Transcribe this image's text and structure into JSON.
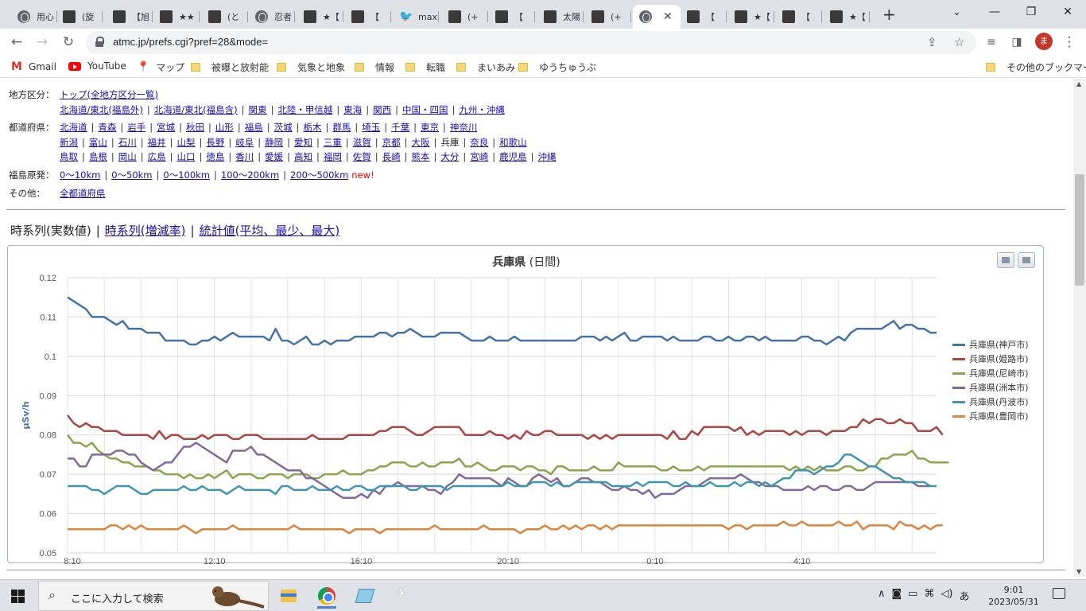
{
  "browser": {
    "tabs": [
      {
        "title": "用心",
        "icon": "globe-icon"
      },
      {
        "title": "(旋",
        "icon": "site-icon"
      },
      {
        "title": "【旭",
        "icon": "site-icon"
      },
      {
        "title": "★★",
        "icon": "site-icon"
      },
      {
        "title": "(と",
        "icon": "site-icon"
      },
      {
        "title": "忍者",
        "icon": "globe-icon"
      },
      {
        "title": "★【",
        "icon": "site-icon"
      },
      {
        "title": "【 ",
        "icon": "site-icon"
      },
      {
        "title": "max",
        "icon": "twitter-icon"
      },
      {
        "title": "(+",
        "icon": "site-icon"
      },
      {
        "title": "【 ",
        "icon": "site-icon"
      },
      {
        "title": "太陽",
        "icon": "site-icon"
      },
      {
        "title": "(+",
        "icon": "site-icon"
      },
      {
        "title": "",
        "icon": "globe-icon",
        "active": true
      },
      {
        "title": "【 ",
        "icon": "site-icon"
      },
      {
        "title": "★【",
        "icon": "site-icon"
      },
      {
        "title": "【 ",
        "icon": "site-icon"
      },
      {
        "title": "★【",
        "icon": "site-icon"
      }
    ],
    "url": "atmc.jp/prefs.cgi?pref=28&mode=",
    "profile_initial": "ま",
    "bookmarks": [
      {
        "label": "Gmail",
        "icon": "gmail-icon"
      },
      {
        "label": "YouTube",
        "icon": "youtube-icon"
      },
      {
        "label": "マップ",
        "icon": "maps-icon"
      },
      {
        "label": "被曝と放射能",
        "icon": "folder-icon"
      },
      {
        "label": "気象と地象",
        "icon": "folder-icon"
      },
      {
        "label": "情報",
        "icon": "folder-icon"
      },
      {
        "label": "転職",
        "icon": "folder-icon"
      },
      {
        "label": "まいあみ",
        "icon": "folder-icon"
      },
      {
        "label": "ゆうちゅうぶ",
        "icon": "folder-icon"
      },
      {
        "label": "その他のブックマーク",
        "icon": "folder-icon"
      }
    ]
  },
  "nav": {
    "region_label": "地方区分：",
    "region_top": "トップ(全地方区分一覧)",
    "regions": [
      "北海道/東北(福島外)",
      "北海道/東北(福島含)",
      "関東",
      "北陸・甲信越",
      "東海",
      "関西",
      "中国・四国",
      "九州・沖縄"
    ],
    "pref_label": "都道府県：",
    "prefs_row1": [
      "北海道",
      "青森",
      "岩手",
      "宮城",
      "秋田",
      "山形",
      "福島",
      "茨城",
      "栃木",
      "群馬",
      "埼玉",
      "千葉",
      "東京",
      "神奈川"
    ],
    "prefs_row2": [
      "新潟",
      "富山",
      "石川",
      "福井",
      "山梨",
      "長野",
      "岐阜",
      "静岡",
      "愛知",
      "三重",
      "滋賀",
      "京都",
      "大阪",
      "兵庫",
      "奈良",
      "和歌山"
    ],
    "prefs_row3": [
      "鳥取",
      "島根",
      "岡山",
      "広島",
      "山口",
      "徳島",
      "香川",
      "愛媛",
      "高知",
      "福岡",
      "佐賀",
      "長崎",
      "熊本",
      "大分",
      "宮崎",
      "鹿児島",
      "沖縄"
    ],
    "current_pref": "兵庫",
    "fukushima_label": "福島原発：",
    "fukushima": [
      "0〜10km",
      "0〜50km",
      "0〜100km",
      "100〜200km",
      "200〜500km"
    ],
    "new_mark": "new!",
    "other_label": "その他：",
    "other": "全都道府県"
  },
  "chart_tabs": {
    "current": "時系列(実数値)",
    "links": [
      "時系列(増減率)",
      "統計値(平均、最少、最大)"
    ]
  },
  "chart_data": {
    "type": "line",
    "title": "兵庫県",
    "subtitle": "(日間)",
    "xlabel": "",
    "ylabel": "μSv/h",
    "ylim": [
      0.05,
      0.12
    ],
    "yticks": [
      "0.05",
      "0.06",
      "0.07",
      "0.08",
      "0.09",
      "0.1",
      "0.11",
      "0.12"
    ],
    "x_tick_labels": [
      "8:10",
      "12:10",
      "16:10",
      "20:10",
      "0:10",
      "4:10"
    ],
    "x_tick_positions": [
      0,
      24,
      48,
      72,
      96,
      120
    ],
    "x_start": "8:10",
    "x_interval_minutes": 10,
    "grid": true,
    "legend_position": "right",
    "series": [
      {
        "name": "兵庫県(神戸市)",
        "color": "#4572a7",
        "values": [
          0.115,
          0.114,
          0.113,
          0.112,
          0.11,
          0.11,
          0.11,
          0.109,
          0.108,
          0.109,
          0.107,
          0.107,
          0.107,
          0.106,
          0.106,
          0.106,
          0.104,
          0.104,
          0.104,
          0.104,
          0.103,
          0.103,
          0.104,
          0.104,
          0.105,
          0.104,
          0.105,
          0.106,
          0.105,
          0.105,
          0.105,
          0.105,
          0.105,
          0.104,
          0.107,
          0.104,
          0.104,
          0.103,
          0.104,
          0.105,
          0.103,
          0.103,
          0.104,
          0.103,
          0.104,
          0.104,
          0.104,
          0.105,
          0.105,
          0.105,
          0.105,
          0.106,
          0.106,
          0.105,
          0.106,
          0.106,
          0.107,
          0.106,
          0.105,
          0.105,
          0.105,
          0.106,
          0.106,
          0.106,
          0.106,
          0.105,
          0.104,
          0.104,
          0.104,
          0.105,
          0.104,
          0.104,
          0.104,
          0.105,
          0.104,
          0.104,
          0.104,
          0.104,
          0.104,
          0.104,
          0.104,
          0.104,
          0.104,
          0.104,
          0.105,
          0.105,
          0.105,
          0.104,
          0.105,
          0.104,
          0.105,
          0.106,
          0.104,
          0.104,
          0.105,
          0.105,
          0.105,
          0.105,
          0.104,
          0.105,
          0.104,
          0.104,
          0.104,
          0.104,
          0.105,
          0.105,
          0.104,
          0.104,
          0.105,
          0.104,
          0.104,
          0.105,
          0.105,
          0.104,
          0.105,
          0.104,
          0.104,
          0.104,
          0.104,
          0.104,
          0.105,
          0.105,
          0.104,
          0.104,
          0.103,
          0.104,
          0.105,
          0.104,
          0.106,
          0.107,
          0.107,
          0.107,
          0.107,
          0.107,
          0.108,
          0.109,
          0.107,
          0.108,
          0.108,
          0.107,
          0.107,
          0.106,
          0.106
        ]
      },
      {
        "name": "兵庫県(姫路市)",
        "color": "#aa4643",
        "values": [
          0.085,
          0.083,
          0.082,
          0.083,
          0.082,
          0.082,
          0.081,
          0.081,
          0.081,
          0.08,
          0.08,
          0.08,
          0.08,
          0.08,
          0.079,
          0.081,
          0.079,
          0.08,
          0.08,
          0.079,
          0.079,
          0.079,
          0.08,
          0.079,
          0.08,
          0.08,
          0.08,
          0.079,
          0.079,
          0.08,
          0.08,
          0.08,
          0.079,
          0.079,
          0.079,
          0.079,
          0.079,
          0.079,
          0.079,
          0.079,
          0.08,
          0.079,
          0.079,
          0.079,
          0.079,
          0.079,
          0.08,
          0.08,
          0.08,
          0.08,
          0.08,
          0.081,
          0.081,
          0.082,
          0.082,
          0.082,
          0.081,
          0.08,
          0.08,
          0.081,
          0.082,
          0.082,
          0.082,
          0.082,
          0.082,
          0.08,
          0.08,
          0.08,
          0.08,
          0.081,
          0.08,
          0.08,
          0.079,
          0.08,
          0.079,
          0.081,
          0.08,
          0.08,
          0.081,
          0.081,
          0.08,
          0.08,
          0.08,
          0.08,
          0.08,
          0.079,
          0.08,
          0.079,
          0.08,
          0.079,
          0.08,
          0.08,
          0.08,
          0.08,
          0.08,
          0.08,
          0.08,
          0.08,
          0.079,
          0.081,
          0.079,
          0.079,
          0.081,
          0.08,
          0.082,
          0.082,
          0.082,
          0.082,
          0.082,
          0.081,
          0.082,
          0.08,
          0.081,
          0.08,
          0.081,
          0.081,
          0.081,
          0.081,
          0.08,
          0.081,
          0.08,
          0.081,
          0.081,
          0.081,
          0.08,
          0.081,
          0.081,
          0.081,
          0.082,
          0.082,
          0.084,
          0.083,
          0.084,
          0.084,
          0.083,
          0.083,
          0.084,
          0.083,
          0.083,
          0.081,
          0.081,
          0.081,
          0.082,
          0.08
        ]
      },
      {
        "name": "兵庫県(尼崎市)",
        "color": "#89a54e",
        "values": [
          0.08,
          0.078,
          0.078,
          0.077,
          0.078,
          0.076,
          0.075,
          0.074,
          0.074,
          0.073,
          0.073,
          0.072,
          0.072,
          0.072,
          0.071,
          0.071,
          0.07,
          0.07,
          0.07,
          0.069,
          0.07,
          0.069,
          0.069,
          0.07,
          0.069,
          0.07,
          0.071,
          0.069,
          0.07,
          0.07,
          0.07,
          0.069,
          0.069,
          0.07,
          0.07,
          0.07,
          0.069,
          0.07,
          0.07,
          0.07,
          0.069,
          0.069,
          0.07,
          0.07,
          0.07,
          0.071,
          0.07,
          0.07,
          0.07,
          0.071,
          0.071,
          0.072,
          0.072,
          0.073,
          0.073,
          0.073,
          0.072,
          0.072,
          0.073,
          0.072,
          0.072,
          0.073,
          0.073,
          0.073,
          0.074,
          0.072,
          0.072,
          0.073,
          0.072,
          0.071,
          0.071,
          0.072,
          0.072,
          0.072,
          0.071,
          0.072,
          0.072,
          0.071,
          0.071,
          0.07,
          0.072,
          0.072,
          0.071,
          0.071,
          0.071,
          0.071,
          0.072,
          0.071,
          0.071,
          0.071,
          0.073,
          0.072,
          0.072,
          0.072,
          0.072,
          0.072,
          0.072,
          0.071,
          0.071,
          0.072,
          0.071,
          0.071,
          0.071,
          0.072,
          0.071,
          0.072,
          0.072,
          0.072,
          0.072,
          0.072,
          0.072,
          0.072,
          0.072,
          0.072,
          0.072,
          0.072,
          0.072,
          0.072,
          0.071,
          0.072,
          0.071,
          0.072,
          0.071,
          0.072,
          0.071,
          0.071,
          0.071,
          0.072,
          0.072,
          0.071,
          0.071,
          0.072,
          0.072,
          0.074,
          0.074,
          0.075,
          0.075,
          0.075,
          0.076,
          0.074,
          0.074,
          0.073,
          0.073,
          0.073,
          0.073
        ]
      },
      {
        "name": "兵庫県(洲本市)",
        "color": "#80699b",
        "values": [
          0.074,
          0.074,
          0.072,
          0.072,
          0.075,
          0.075,
          0.075,
          0.075,
          0.076,
          0.076,
          0.075,
          0.075,
          0.073,
          0.072,
          0.071,
          0.072,
          0.073,
          0.073,
          0.075,
          0.077,
          0.077,
          0.078,
          0.077,
          0.076,
          0.075,
          0.074,
          0.073,
          0.076,
          0.076,
          0.076,
          0.077,
          0.075,
          0.075,
          0.074,
          0.073,
          0.072,
          0.071,
          0.071,
          0.071,
          0.069,
          0.069,
          0.068,
          0.067,
          0.066,
          0.065,
          0.064,
          0.064,
          0.064,
          0.065,
          0.064,
          0.066,
          0.065,
          0.067,
          0.067,
          0.068,
          0.067,
          0.067,
          0.067,
          0.067,
          0.066,
          0.066,
          0.065,
          0.067,
          0.068,
          0.07,
          0.069,
          0.069,
          0.069,
          0.069,
          0.069,
          0.068,
          0.067,
          0.069,
          0.068,
          0.067,
          0.067,
          0.069,
          0.07,
          0.069,
          0.068,
          0.069,
          0.067,
          0.067,
          0.068,
          0.069,
          0.069,
          0.068,
          0.068,
          0.067,
          0.066,
          0.066,
          0.067,
          0.066,
          0.066,
          0.065,
          0.066,
          0.064,
          0.065,
          0.065,
          0.065,
          0.066,
          0.067,
          0.067,
          0.067,
          0.068,
          0.069,
          0.069,
          0.069,
          0.069,
          0.069,
          0.07,
          0.069,
          0.068,
          0.068,
          0.067,
          0.067,
          0.067,
          0.066,
          0.066,
          0.066,
          0.066,
          0.067,
          0.066,
          0.067,
          0.067,
          0.066,
          0.066,
          0.067,
          0.067,
          0.066,
          0.066,
          0.067,
          0.068,
          0.068,
          0.068,
          0.068,
          0.068,
          0.068,
          0.068,
          0.067,
          0.067,
          0.067
        ]
      },
      {
        "name": "兵庫県(丹波市)",
        "color": "#3d96ae",
        "values": [
          0.067,
          0.067,
          0.067,
          0.067,
          0.066,
          0.066,
          0.065,
          0.066,
          0.067,
          0.067,
          0.067,
          0.066,
          0.065,
          0.065,
          0.066,
          0.066,
          0.066,
          0.066,
          0.066,
          0.067,
          0.066,
          0.066,
          0.067,
          0.066,
          0.066,
          0.066,
          0.065,
          0.066,
          0.067,
          0.066,
          0.066,
          0.066,
          0.066,
          0.066,
          0.065,
          0.067,
          0.067,
          0.066,
          0.066,
          0.066,
          0.067,
          0.066,
          0.066,
          0.066,
          0.067,
          0.066,
          0.066,
          0.067,
          0.067,
          0.066,
          0.066,
          0.067,
          0.067,
          0.067,
          0.067,
          0.067,
          0.066,
          0.066,
          0.067,
          0.067,
          0.067,
          0.067,
          0.066,
          0.067,
          0.067,
          0.067,
          0.067,
          0.067,
          0.067,
          0.067,
          0.067,
          0.067,
          0.068,
          0.067,
          0.067,
          0.067,
          0.068,
          0.068,
          0.068,
          0.067,
          0.068,
          0.067,
          0.067,
          0.068,
          0.068,
          0.068,
          0.068,
          0.068,
          0.068,
          0.067,
          0.067,
          0.067,
          0.067,
          0.068,
          0.067,
          0.068,
          0.068,
          0.068,
          0.068,
          0.067,
          0.067,
          0.068,
          0.067,
          0.067,
          0.067,
          0.068,
          0.067,
          0.067,
          0.067,
          0.068,
          0.067,
          0.068,
          0.068,
          0.067,
          0.068,
          0.067,
          0.068,
          0.069,
          0.069,
          0.071,
          0.071,
          0.071,
          0.07,
          0.071,
          0.072,
          0.072,
          0.073,
          0.075,
          0.075,
          0.074,
          0.073,
          0.072,
          0.072,
          0.071,
          0.07,
          0.069,
          0.069,
          0.068,
          0.068,
          0.068,
          0.068,
          0.067,
          0.067
        ]
      },
      {
        "name": "兵庫県(豊岡市)",
        "color": "#db843d",
        "values": [
          0.056,
          0.056,
          0.056,
          0.056,
          0.056,
          0.056,
          0.056,
          0.057,
          0.057,
          0.056,
          0.057,
          0.056,
          0.057,
          0.056,
          0.056,
          0.056,
          0.056,
          0.056,
          0.056,
          0.057,
          0.056,
          0.055,
          0.056,
          0.056,
          0.056,
          0.056,
          0.056,
          0.057,
          0.056,
          0.056,
          0.056,
          0.056,
          0.056,
          0.056,
          0.056,
          0.056,
          0.056,
          0.057,
          0.056,
          0.056,
          0.056,
          0.056,
          0.056,
          0.056,
          0.056,
          0.056,
          0.055,
          0.056,
          0.056,
          0.056,
          0.056,
          0.055,
          0.056,
          0.056,
          0.056,
          0.056,
          0.056,
          0.056,
          0.056,
          0.056,
          0.057,
          0.056,
          0.056,
          0.056,
          0.056,
          0.056,
          0.056,
          0.056,
          0.057,
          0.056,
          0.056,
          0.056,
          0.056,
          0.056,
          0.055,
          0.056,
          0.056,
          0.056,
          0.057,
          0.056,
          0.056,
          0.057,
          0.056,
          0.057,
          0.056,
          0.057,
          0.057,
          0.056,
          0.057,
          0.056,
          0.057,
          0.057,
          0.057,
          0.057,
          0.057,
          0.057,
          0.057,
          0.057,
          0.057,
          0.057,
          0.057,
          0.057,
          0.057,
          0.057,
          0.057,
          0.057,
          0.057,
          0.057,
          0.056,
          0.057,
          0.057,
          0.056,
          0.057,
          0.057,
          0.057,
          0.057,
          0.057,
          0.058,
          0.057,
          0.057,
          0.058,
          0.057,
          0.057,
          0.057,
          0.057,
          0.057,
          0.058,
          0.057,
          0.057,
          0.058,
          0.056,
          0.057,
          0.057,
          0.057,
          0.057,
          0.056,
          0.058,
          0.057,
          0.057,
          0.056,
          0.057,
          0.056,
          0.057,
          0.057
        ]
      }
    ]
  },
  "taskbar": {
    "search_placeholder": "ここに入力して検索",
    "ime": "あ",
    "time": "9:01",
    "date": "2023/05/31"
  }
}
